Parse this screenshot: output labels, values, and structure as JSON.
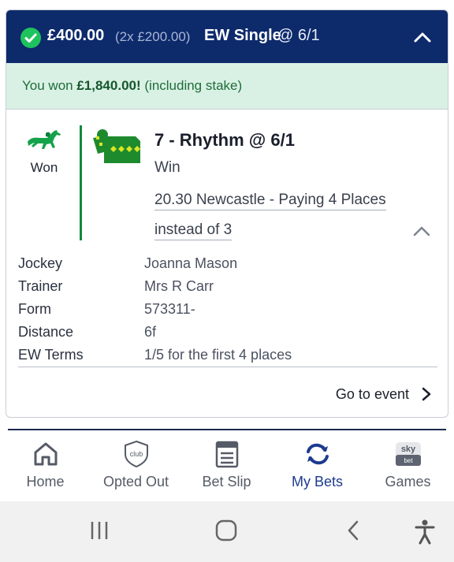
{
  "bet_header": {
    "amount": "£400.00",
    "stake_breakdown": "(2x £200.00)",
    "bet_type": "EW Single",
    "odds": "@ 6/1"
  },
  "win_banner": {
    "prefix": "You won",
    "amount": "£1,840.00!",
    "suffix": "(including stake)"
  },
  "runner": {
    "status": "Won",
    "title": "7 - Rhythm @ 6/1",
    "result": "Win",
    "race_line1": "20.30 Newcastle - Paying 4 Places",
    "race_line2": "instead of 3"
  },
  "details": [
    {
      "label": "Jockey",
      "value": "Joanna Mason"
    },
    {
      "label": "Trainer",
      "value": "Mrs R Carr"
    },
    {
      "label": "Form",
      "value": "573311-"
    },
    {
      "label": "Distance",
      "value": "6f"
    },
    {
      "label": "EW Terms",
      "value": "1/5 for the first 4 places"
    }
  ],
  "goto_event": "Go to event",
  "nav": {
    "home": "Home",
    "opted_out": "Opted Out",
    "club_badge": "club",
    "bet_slip": "Bet Slip",
    "my_bets": "My Bets",
    "games": "Games",
    "games_logo_top": "sky",
    "games_logo_bottom": "bet"
  },
  "colors": {
    "header_bg": "#0d2a6b",
    "success_green": "#1ec35d",
    "win_banner_bg": "#d9f1e4",
    "active_nav": "#1d3b8f"
  }
}
